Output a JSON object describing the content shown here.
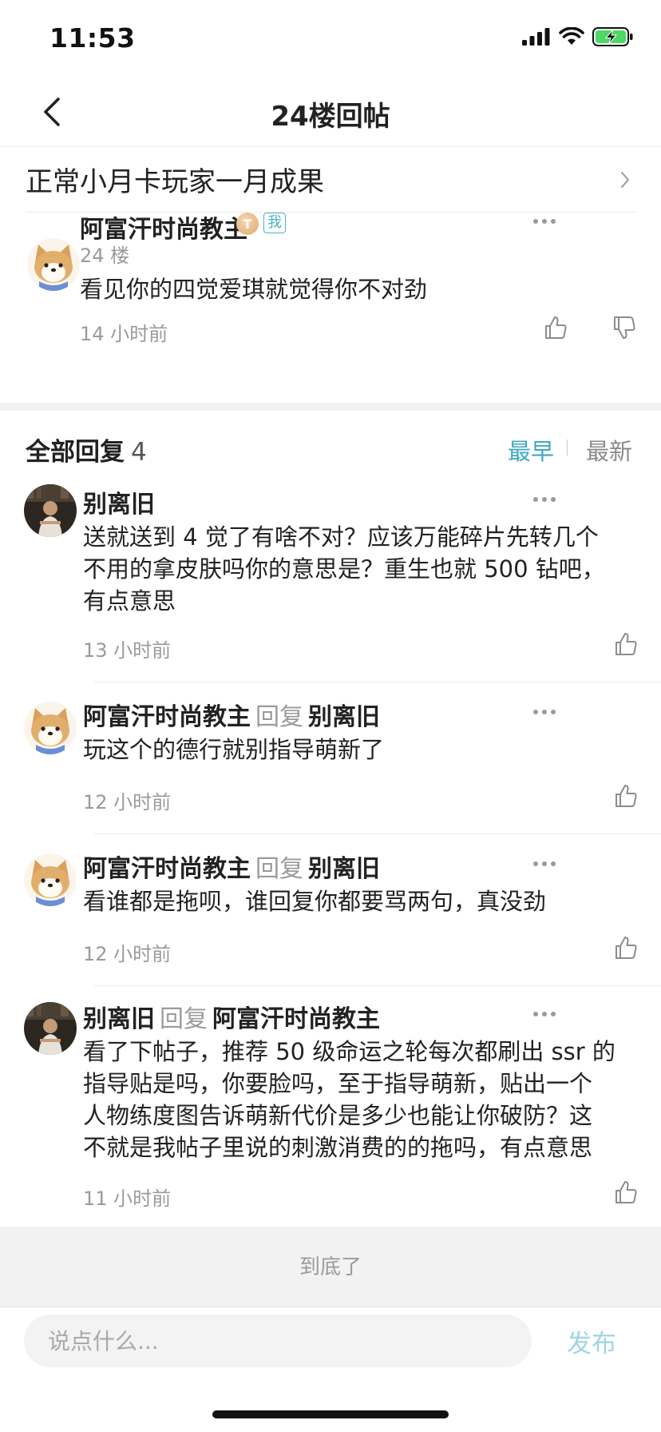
{
  "status_bar": {
    "time": "11:53"
  },
  "nav": {
    "title": "24楼回帖"
  },
  "post_link": {
    "title": "正常小月卡玩家一月成果"
  },
  "main_comment": {
    "author": "阿富汗时尚教主",
    "badge_level": "T",
    "badge_me": "我",
    "floor": "24 楼",
    "text": "看见你的四觉爱琪就觉得你不对劲",
    "time": "14 小时前"
  },
  "replies_header": {
    "title": "全部回复",
    "count": "4",
    "sort_earliest": "最早",
    "sort_latest": "最新"
  },
  "replies": [
    {
      "author": "别离旧",
      "reply_word": "",
      "reply_to": "",
      "lines": [
        "送就送到 4 觉了有啥不对？应该万能碎片先转几个",
        "不用的拿皮肤吗你的意思是？重生也就 500 钻吧，",
        "有点意思"
      ],
      "time": "13 小时前"
    },
    {
      "author": "阿富汗时尚教主",
      "reply_word": "回复",
      "reply_to": "别离旧",
      "lines": [
        "玩这个的德行就别指导萌新了"
      ],
      "time": "12 小时前"
    },
    {
      "author": "阿富汗时尚教主",
      "reply_word": "回复",
      "reply_to": "别离旧",
      "lines": [
        "看谁都是拖呗，谁回复你都要骂两句，真没劲"
      ],
      "time": "12 小时前"
    },
    {
      "author": "别离旧",
      "reply_word": "回复",
      "reply_to": "阿富汗时尚教主",
      "lines": [
        "看了下帖子，推荐 50 级命运之轮每次都刷出 ssr 的",
        "指导贴是吗，你要脸吗，至于指导萌新，贴出一个",
        "人物练度图告诉萌新代价是多少也能让你破防？这",
        "不就是我帖子里说的刺激消费的的拖吗，有点意思"
      ],
      "time": "11 小时前"
    }
  ],
  "footer": {
    "end_text": "到底了",
    "input_placeholder": "说点什么...",
    "publish": "发布"
  },
  "colors": {
    "accent": "#3fa9c1",
    "publish": "#9fd5e2",
    "muted": "#9a9a9a"
  }
}
